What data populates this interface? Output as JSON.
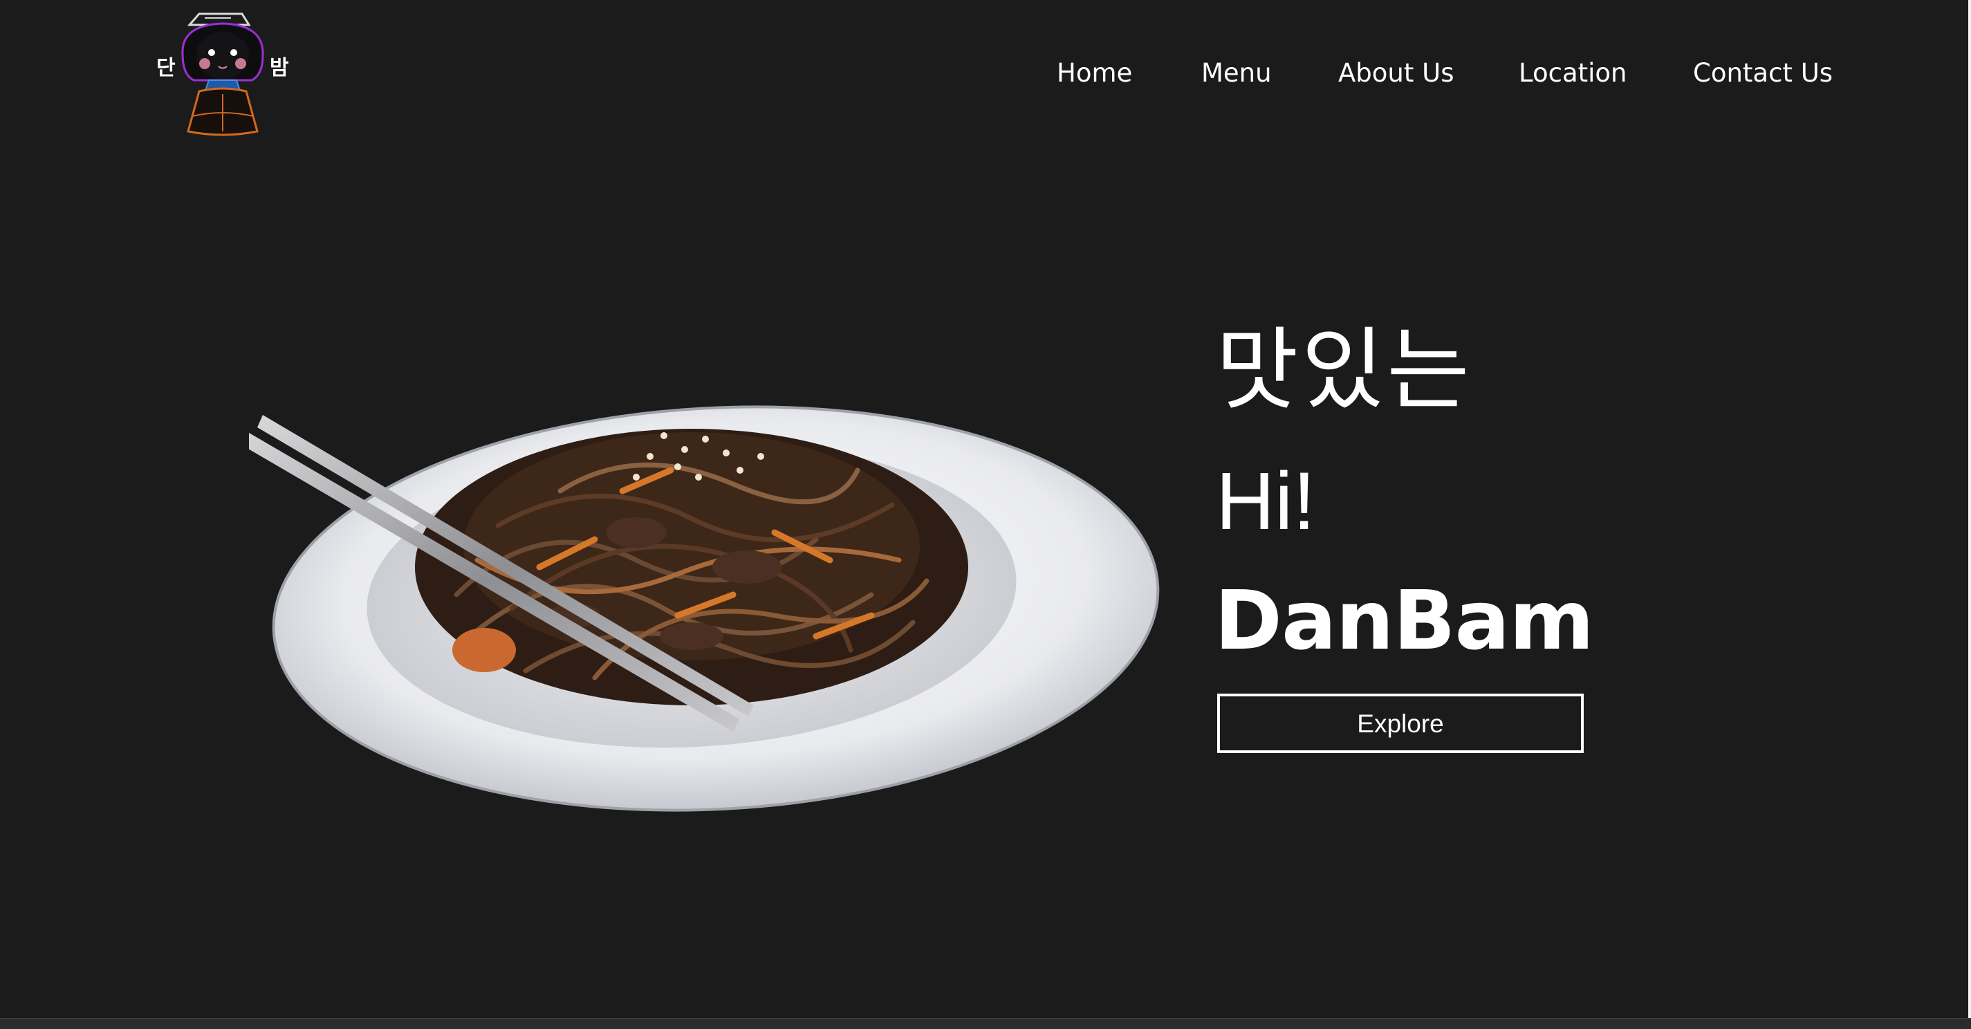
{
  "logo": {
    "left_glyph": "단",
    "right_glyph": "밤",
    "icon": "hanbok-girl-mascot-icon"
  },
  "nav": {
    "items": [
      {
        "label": "Home"
      },
      {
        "label": "Menu"
      },
      {
        "label": "About Us"
      },
      {
        "label": "Location"
      },
      {
        "label": "Contact Us"
      }
    ]
  },
  "hero": {
    "korean_line": "맛있는",
    "greeting": "Hi!",
    "brand": "DanBam",
    "cta_label": "Explore",
    "image_icon": "japchae-noodle-plate-image"
  },
  "colors": {
    "background": "#1b1b1c",
    "text": "#ffffff",
    "accent_purple": "#8a2be2",
    "accent_orange": "#d2691e"
  }
}
